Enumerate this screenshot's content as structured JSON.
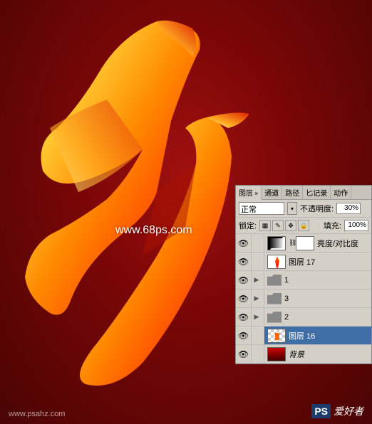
{
  "watermark": "www.68ps.com",
  "watermark_bottom_url": "www.psahz.com",
  "watermark_bottom_logo": "PS",
  "watermark_bottom_text": "爱好者",
  "panel": {
    "tabs": [
      "图层",
      "通道",
      "路径",
      "记录",
      "动作"
    ],
    "tab_x": "×",
    "tab_pre": "匕",
    "blend_mode": "正常",
    "opacity_label": "不透明度:",
    "opacity_value": "30%",
    "lock_label": "锁定:",
    "fill_label": "填充:",
    "fill_value": "100%"
  },
  "layers": [
    {
      "name": "亮度/对比度",
      "type": "adjustment"
    },
    {
      "name": "图层 17",
      "type": "fire"
    },
    {
      "name": "1",
      "type": "folder"
    },
    {
      "name": "3",
      "type": "folder"
    },
    {
      "name": "2",
      "type": "folder"
    },
    {
      "name": "图层 16",
      "type": "transp",
      "selected": true
    },
    {
      "name": "背景",
      "type": "bg"
    }
  ]
}
